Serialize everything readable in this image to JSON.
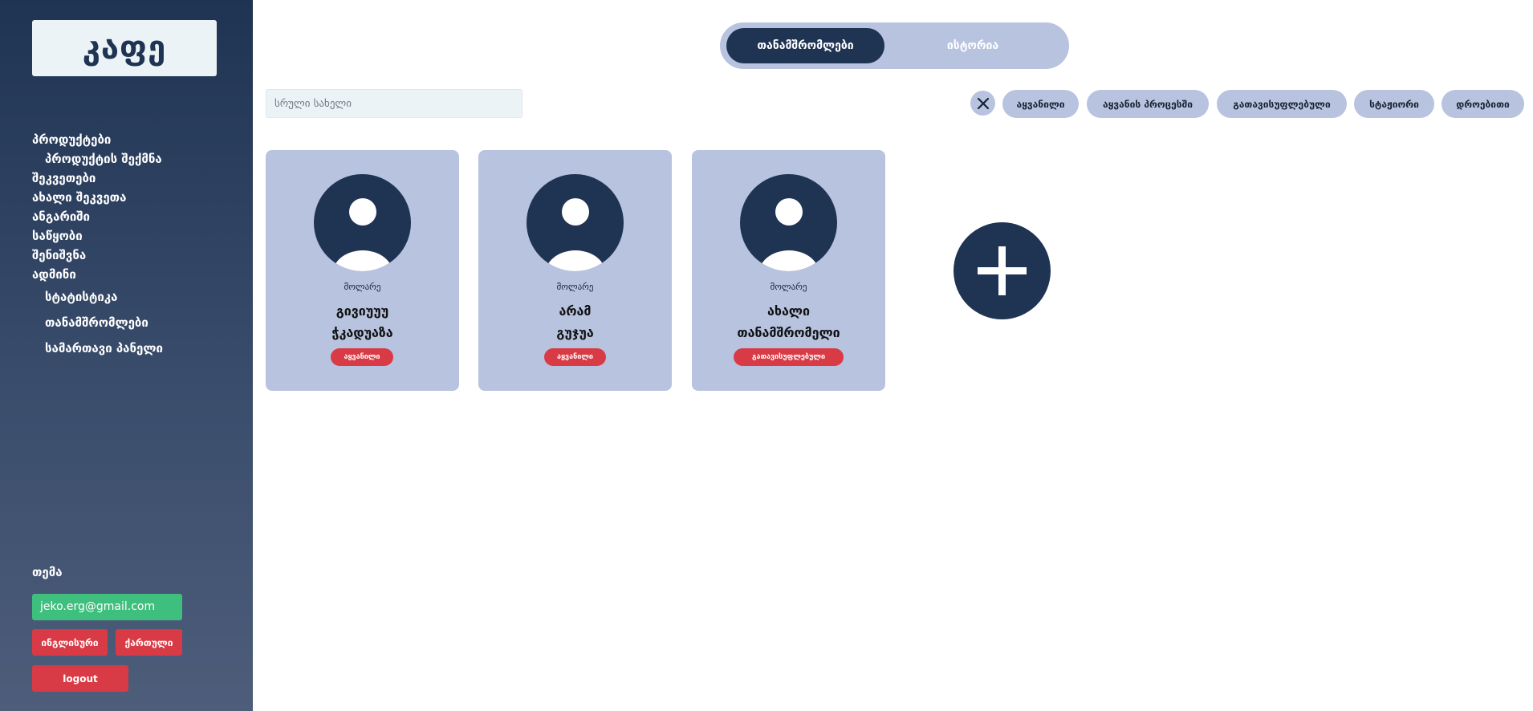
{
  "sidebar": {
    "logo": "კაფე",
    "nav": [
      "პროდუქტები",
      "პროდუქტის შექმნა",
      "შეკვეთები",
      "ახალი შეკვეთა",
      "ანგარიში",
      "საწყობი",
      "შენიშვნა",
      "ადმინი",
      "სტატისტიკა",
      "თანამშრომლები",
      "სამართავი პანელი"
    ],
    "theme_label": "თემა",
    "email": "jeko.erg@gmail.com",
    "lang_english": "ინგლისური",
    "lang_georgian": "ქართული",
    "logout": "logout"
  },
  "tabs": {
    "employees": "თანამშრომლები",
    "history": "ისტორია"
  },
  "search": {
    "placeholder": "სრული სახელი"
  },
  "filters": [
    "აყვანილი",
    "აყვანის პროცესში",
    "გათავისუფლებული",
    "სტაჟიორი",
    "დროებითი"
  ],
  "employees": [
    {
      "role": "მოლარე",
      "name_line1": "გივიუუუ",
      "name_line2": "ჭკადუაზა",
      "status": "აყვანილი"
    },
    {
      "role": "მოლარე",
      "name_line1": "არამ",
      "name_line2": "გუჯუა",
      "status": "აყვანილი"
    },
    {
      "role": "მოლარე",
      "name_line1": "ახალი",
      "name_line2": "თანამშრომელი",
      "status": "გათავისუფლებული"
    }
  ],
  "colors": {
    "sidebar_top": "#1f3353",
    "accent_light": "#b8c3e0",
    "success": "#3fbf7e",
    "danger": "#d93b46"
  },
  "icons": {
    "clear": "close-icon",
    "add": "plus-icon",
    "avatar": "user-avatar-icon"
  }
}
